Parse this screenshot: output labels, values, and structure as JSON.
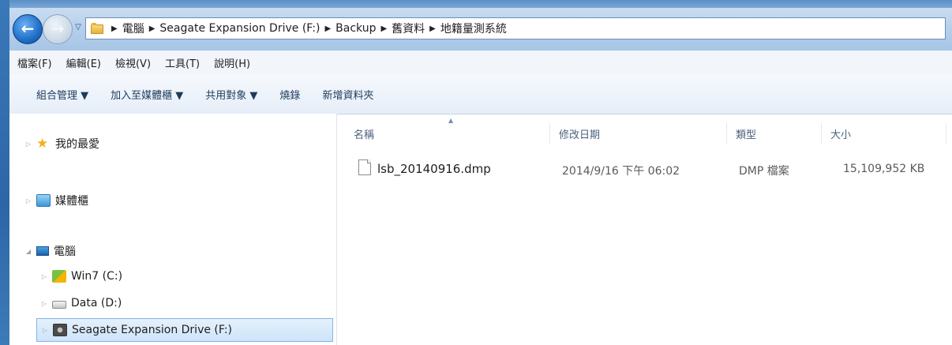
{
  "address_bar": {
    "crumbs": [
      "電腦",
      "Seagate Expansion Drive (F:)",
      "Backup",
      "舊資料",
      "地籍量測系統"
    ]
  },
  "menu": {
    "items": [
      "檔案(F)",
      "編輯(E)",
      "檢視(V)",
      "工具(T)",
      "說明(H)"
    ]
  },
  "command_bar": {
    "items": [
      "組合管理 ▼",
      "加入至媒體櫃 ▼",
      "共用對象 ▼",
      "燒錄",
      "新增資料夾"
    ]
  },
  "nav_pane": {
    "favorites": "我的最愛",
    "libraries": "媒體櫃",
    "computer": "電腦",
    "drives": [
      "Win7 (C:)",
      "Data (D:)",
      "Seagate Expansion Drive (F:)"
    ]
  },
  "columns": {
    "name": "名稱",
    "modified": "修改日期",
    "type": "類型",
    "size": "大小"
  },
  "files": [
    {
      "name": "lsb_20140916.dmp",
      "modified": "2014/9/16 下午 06:02",
      "type": "DMP 檔案",
      "size": "15,109,952 KB"
    }
  ],
  "icons": {
    "back": "back-arrow-icon",
    "forward": "forward-arrow-icon",
    "history": "chevron-down-icon",
    "folder": "folder-icon",
    "favorites": "star-icon",
    "libraries": "library-icon",
    "computer": "computer-icon",
    "drive_c": "windows-drive-icon",
    "drive_d": "hard-drive-icon",
    "drive_f": "external-drive-icon",
    "file": "file-icon"
  }
}
